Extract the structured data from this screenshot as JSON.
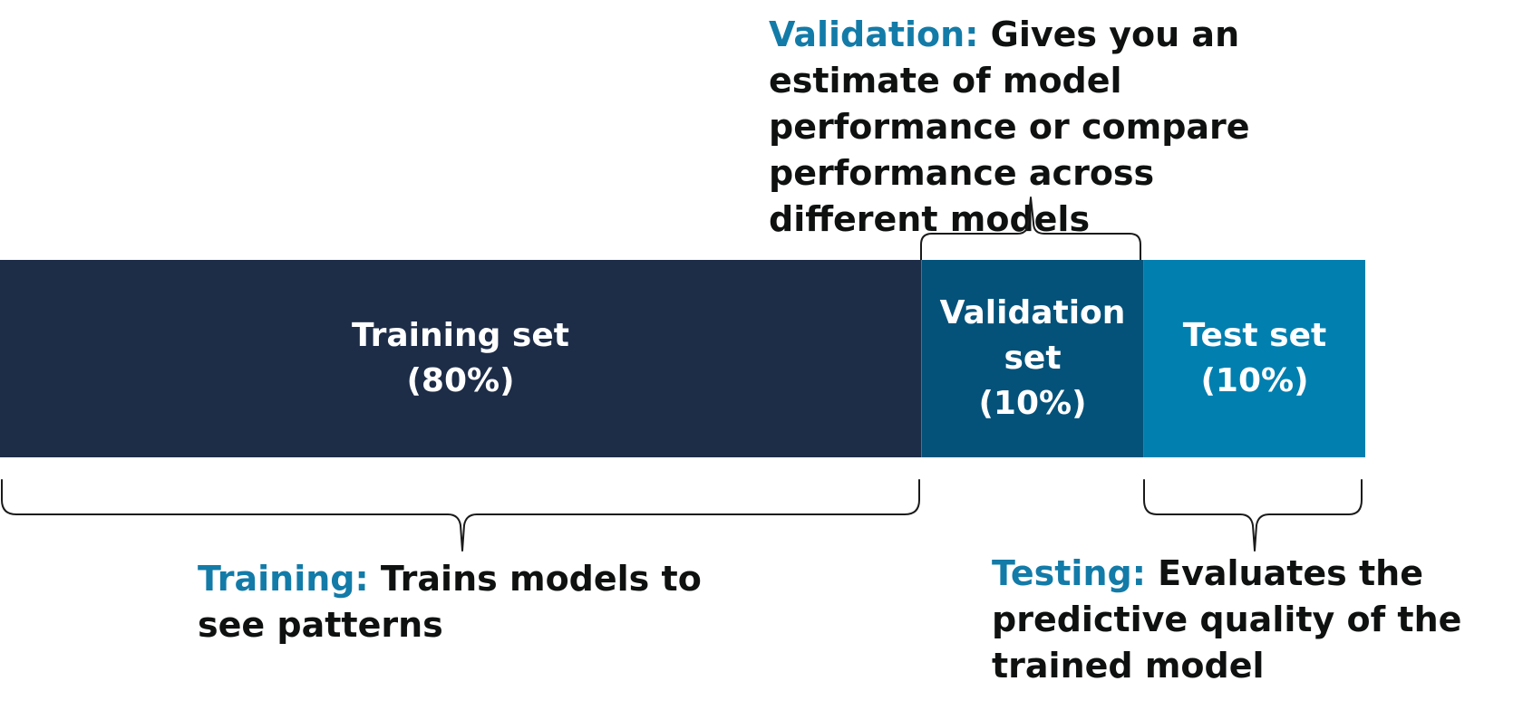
{
  "segments": {
    "training": {
      "line1": "Training set",
      "line2": "(80%)"
    },
    "validation": {
      "line1": "Validation",
      "line2": "set",
      "line3": "(10%)"
    },
    "test": {
      "line1": "Test set",
      "line2": "(10%)"
    }
  },
  "notes": {
    "validation": {
      "term": "Validation:",
      "text": "Gives you an estimate of model performance or compare performance across different models"
    },
    "training": {
      "term": "Training:",
      "text": "Trains models to see patterns"
    },
    "testing": {
      "term": "Testing:",
      "text": "Evaluates the predictive quality of the trained model"
    }
  },
  "colors": {
    "training_segment": "#1d2c47",
    "validation_segment": "#04527a",
    "test_segment": "#017faf",
    "term_accent": "#137ba8"
  }
}
